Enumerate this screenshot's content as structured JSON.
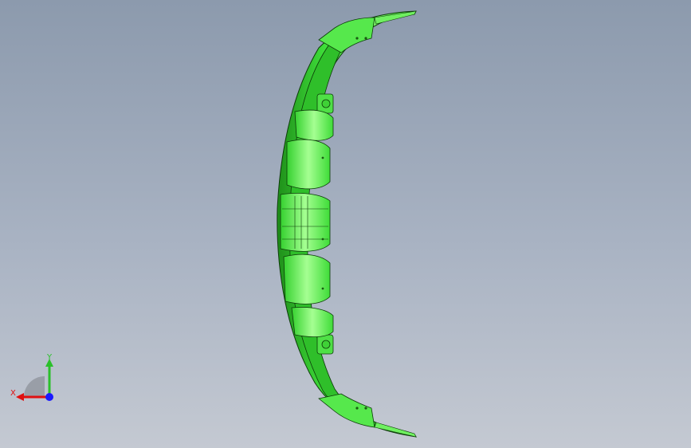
{
  "viewport": {
    "background_top": "#8c9aad",
    "background_bottom": "#c4c9d2"
  },
  "model": {
    "part": "bumper-lip",
    "fill_color": "#3fe03a",
    "highlight_color": "#8cff7a",
    "edge_color": "#0c3a08"
  },
  "triad": {
    "x_label": "X",
    "y_label": "Y",
    "x_color": "#e01010",
    "y_color": "#2ac02a",
    "z_color": "#1a1aff"
  }
}
